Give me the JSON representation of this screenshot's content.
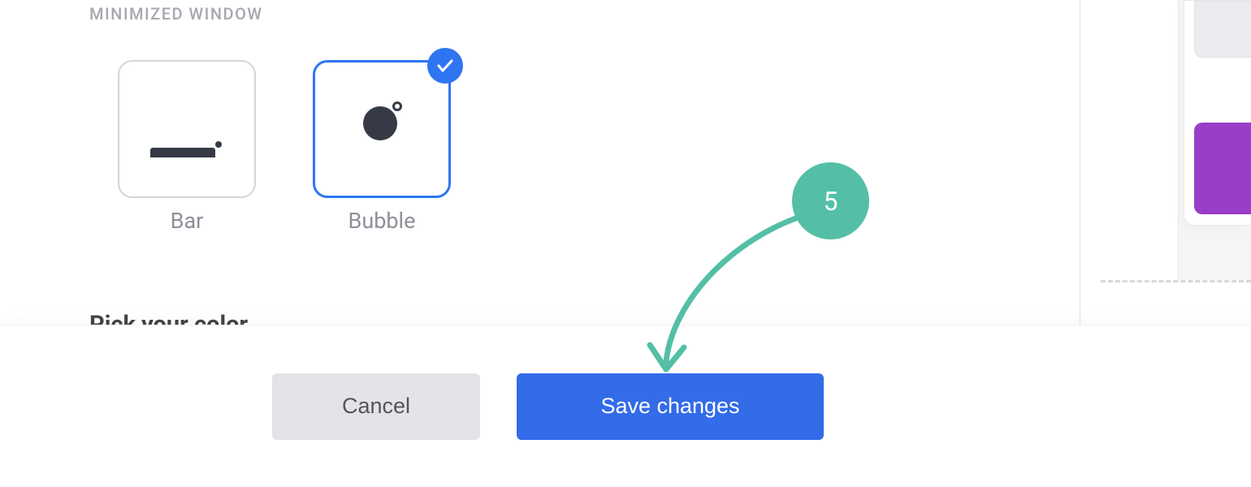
{
  "section": {
    "label": "MINIMIZED WINDOW"
  },
  "options": {
    "bar": {
      "label": "Bar"
    },
    "bubble": {
      "label": "Bubble",
      "selected": true
    }
  },
  "colorSection": {
    "title": "Pick your color"
  },
  "footer": {
    "cancel": "Cancel",
    "save": "Save changes"
  },
  "step": {
    "number": "5"
  },
  "colors": {
    "accent": "#336be8",
    "badge": "#54bfa6",
    "purple": "#9a3ec9"
  }
}
